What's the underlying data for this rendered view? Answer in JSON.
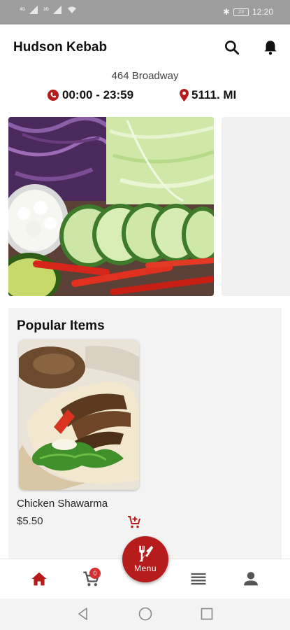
{
  "status_bar": {
    "sim1": "4G",
    "sim2": "3G",
    "time": "12:20",
    "battery_level": "23"
  },
  "header": {
    "title": "Hudson Kebab",
    "icons": [
      "search-icon",
      "bell-icon"
    ]
  },
  "location": {
    "address": "464 Broadway",
    "hours": "00:00 - 23:59",
    "distance": "5111. MI"
  },
  "popular": {
    "title": "Popular Items",
    "items": [
      {
        "name": "Chicken Shawarma",
        "price": "$5.50"
      }
    ]
  },
  "bottom_nav": {
    "items": [
      "home-icon",
      "cart-icon",
      "menu-fab",
      "list-icon",
      "profile-icon"
    ],
    "cart_count": "0",
    "menu_label": "Menu",
    "active": "home"
  },
  "colors": {
    "accent": "#b71c1c",
    "status_bar": "#9e9e9e",
    "card_bg": "#f3f3f3"
  }
}
